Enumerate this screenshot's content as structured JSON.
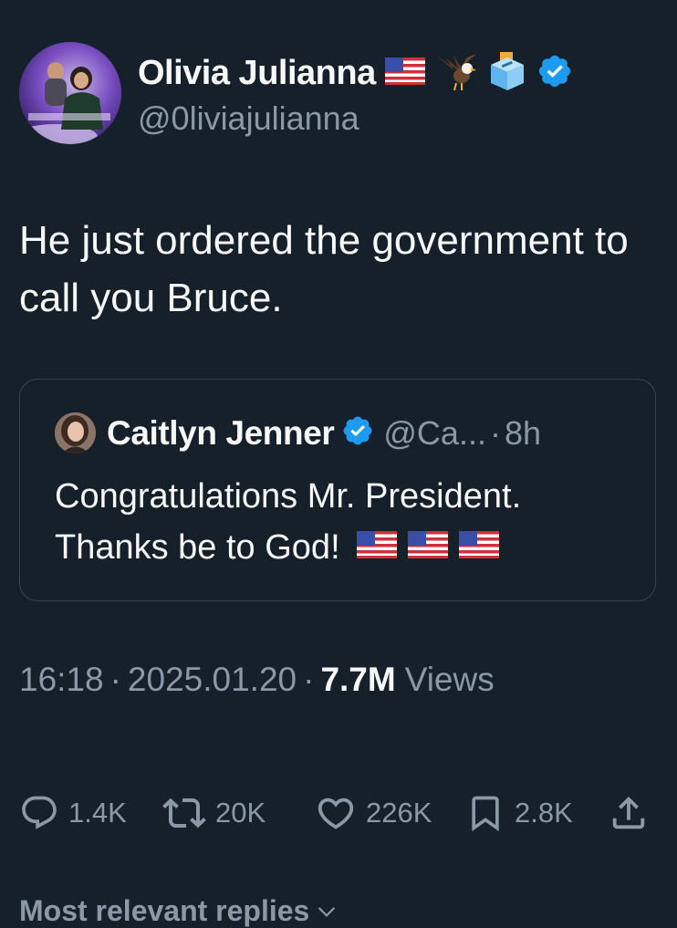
{
  "author": {
    "display_name": "Olivia Julianna",
    "handle": "@0liviajulianna",
    "name_emojis": [
      "us-flag-emoji",
      "eagle-emoji",
      "ballot-box-emoji"
    ],
    "verified": true
  },
  "tweet": {
    "text": "He just ordered the government to call you Bruce."
  },
  "quoted_tweet": {
    "display_name": "Caitlyn Jenner",
    "handle": "@Ca...",
    "separator": "·",
    "time": "8h",
    "verified": true,
    "text_line1": "Congratulations Mr. President.",
    "text_line2": "Thanks be to God!",
    "trailing_emojis": [
      "us-flag-emoji",
      "us-flag-emoji",
      "us-flag-emoji"
    ]
  },
  "meta": {
    "time": "16:18",
    "separator": "·",
    "date": "2025.01.20",
    "views_count": "7.7M",
    "views_label": "Views"
  },
  "actions": {
    "replies": "1.4K",
    "reposts": "20K",
    "likes": "226K",
    "bookmarks": "2.8K"
  },
  "replies_sort": {
    "label": "Most relevant replies"
  },
  "colors": {
    "background": "#15202b",
    "text_primary": "#f7f9f9",
    "text_secondary": "#8b98a5",
    "verified_blue": "#1d9bf0",
    "border": "#38444d"
  }
}
